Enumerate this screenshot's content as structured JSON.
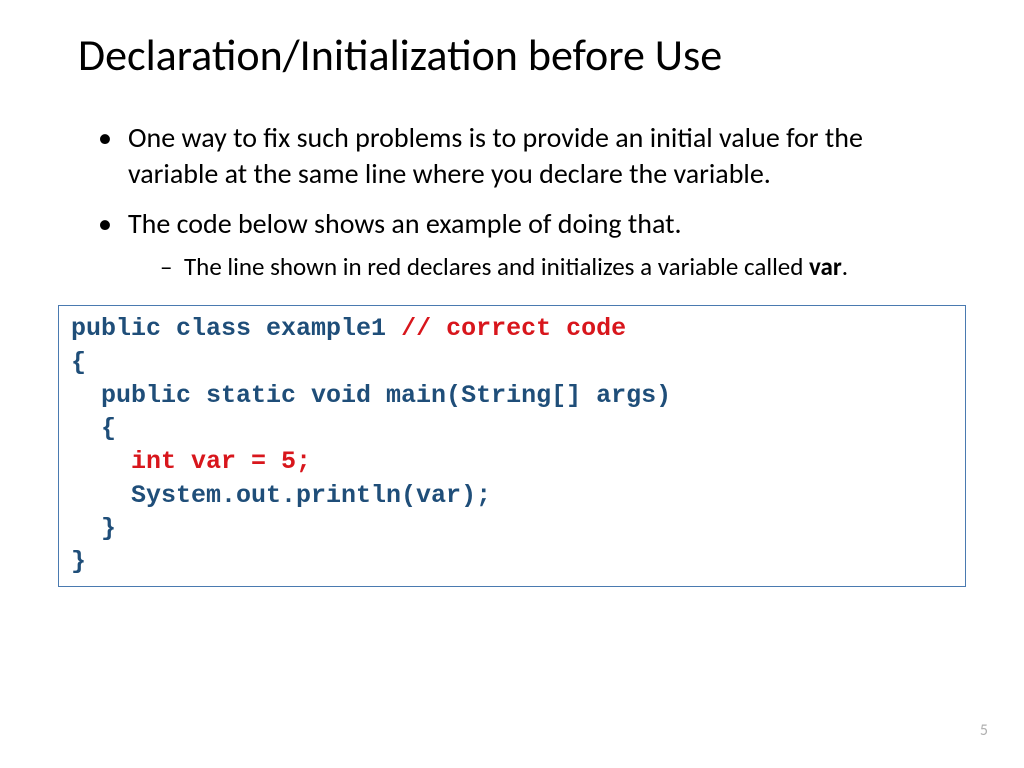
{
  "title": "Declaration/Initialization before Use",
  "bullets": {
    "b1": "One way to fix such problems is to provide an initial value for the variable at the same line where you declare the variable.",
    "b2": "The code below shows an example of doing that.",
    "sub1_prefix": "The line shown in red declares and initializes a variable called ",
    "sub1_bold": "var",
    "sub1_suffix": "."
  },
  "code": {
    "l1a": "public class example1 ",
    "l1b": "// correct code",
    "l2": "{",
    "l3": "  public static void main(String[] args)",
    "l4": "  {",
    "l5_pad": "    ",
    "l5_red": "int var = 5;",
    "l6": "    System.out.println(var);",
    "l7": "  }",
    "l8": "}"
  },
  "page": "5"
}
